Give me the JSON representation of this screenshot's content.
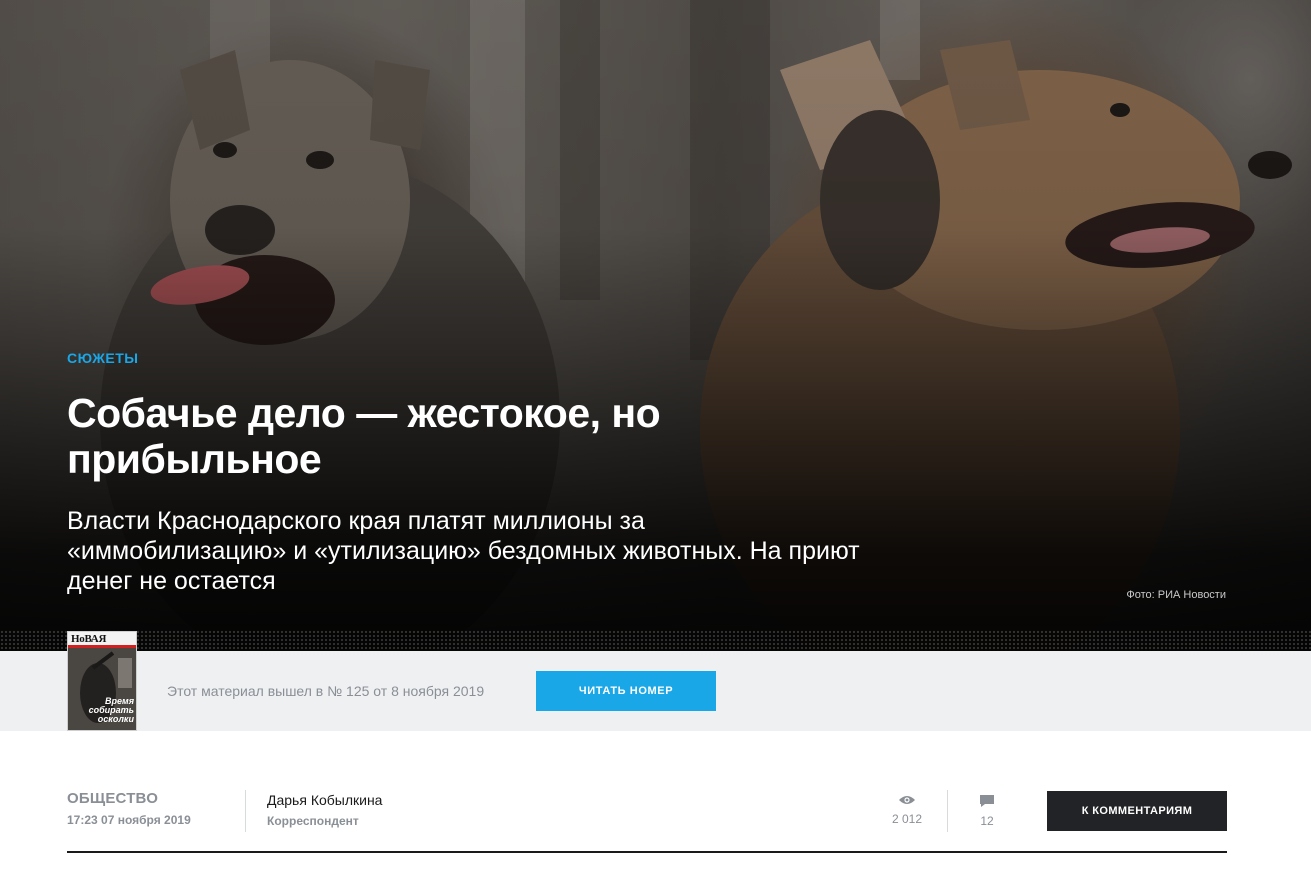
{
  "hero": {
    "rubric": "СЮЖЕТЫ",
    "title": "Собачье дело — жестокое, но прибыльное",
    "lead": "Власти Краснодарского края платят миллионы за «иммобилизацию» и «утилизацию» бездомных животных. На приют денег не остается",
    "photo_credit": "Фото: РИА Новости"
  },
  "issue": {
    "cover_logo": "НоВАЯ",
    "cover_headline": "Время собирать осколки",
    "text": "Этот материал вышел в № 125 от 8 ноября 2019",
    "button_label": "ЧИТАТЬ НОМЕР"
  },
  "meta": {
    "section": "ОБЩЕСТВО",
    "date": "17:23 07 ноября 2019",
    "author_name": "Дарья Кобылкина",
    "author_role": "Корреспондент",
    "views": "2 012",
    "comments": "12",
    "comments_button": "К КОММЕНТАРИЯМ"
  },
  "colors": {
    "accent": "#1aa7e8",
    "dark_button": "#222326",
    "muted_text": "#8a8f96",
    "issue_bar_bg": "#eff0f2"
  },
  "icons": [
    "eye-icon",
    "comment-icon"
  ]
}
